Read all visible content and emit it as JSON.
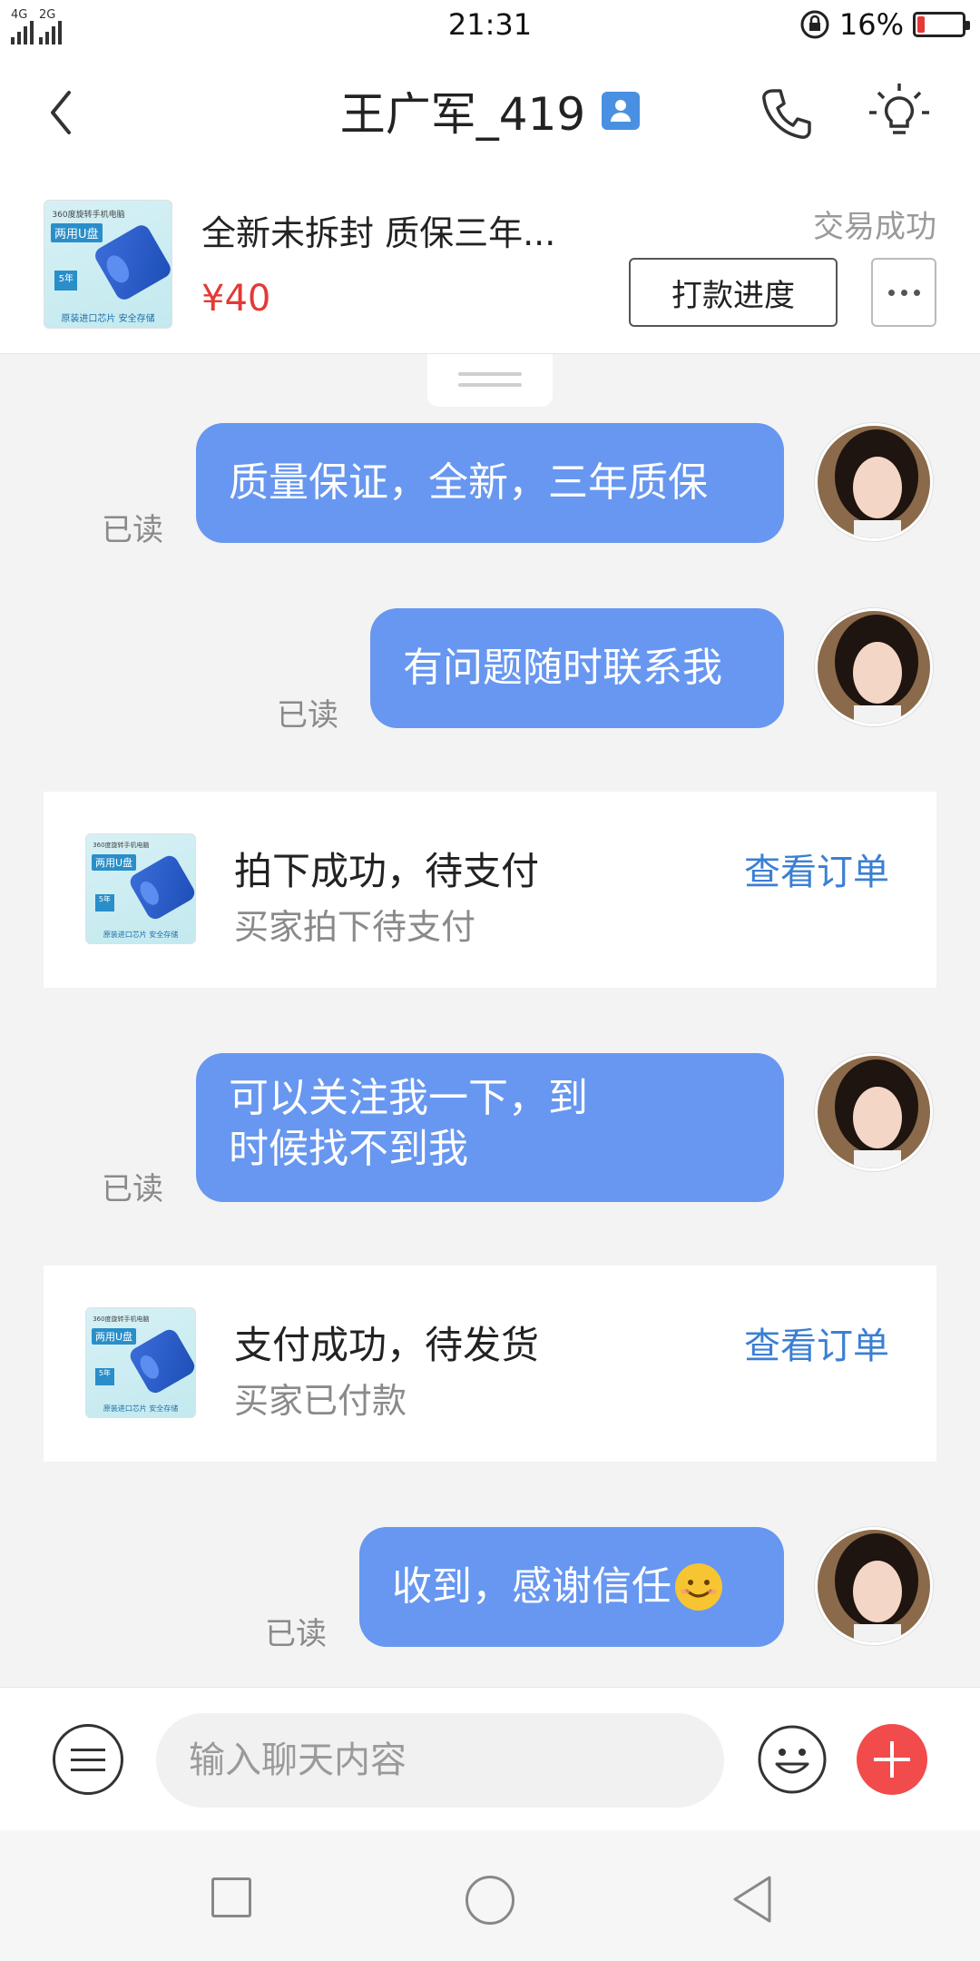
{
  "status_bar": {
    "network_1": "4G",
    "network_2": "2G",
    "time": "21:31",
    "battery_percent": "16%",
    "battery_level": 0.16
  },
  "header": {
    "title": "王广军_419",
    "back_icon": "chevron-left-icon",
    "badge_icon": "person-badge-icon",
    "call_icon": "phone-icon",
    "tip_icon": "lightbulb-icon"
  },
  "product": {
    "thumb_top": "360度旋转手机电脑",
    "thumb_brand": "两用U盘",
    "thumb_five": "5年",
    "thumb_bottom": "原装进口芯片 安全存储",
    "title": "全新未拆封 质保三年...",
    "price": "¥40",
    "status": "交易成功",
    "pay_progress_label": "打款进度",
    "more_icon": "more-dots-icon"
  },
  "messages": [
    {
      "text": "质量保证，全新，三年质保",
      "read": "已读"
    },
    {
      "text": "有问题随时联系我",
      "read": "已读"
    },
    {
      "text": "可以关注我一下，到时候找不到我",
      "read": "已读"
    },
    {
      "text": "收到，感谢信任",
      "read": "已读",
      "emoji_icon": "smiling-face-icon"
    }
  ],
  "system_cards": [
    {
      "title": "拍下成功，待支付",
      "subtitle": "买家拍下待支付",
      "link": "查看订单"
    },
    {
      "title": "支付成功，待发货",
      "subtitle": "买家已付款",
      "link": "查看订单"
    }
  ],
  "input_bar": {
    "placeholder": "输入聊天内容",
    "menu_icon": "menu-icon",
    "emoji_icon": "emoji-icon",
    "plus_icon": "plus-icon"
  },
  "nav_bar": {
    "recent_icon": "square-icon",
    "home_icon": "circle-icon",
    "back_icon": "triangle-back-icon"
  },
  "colors": {
    "bubble": "#6797f0",
    "price": "#e53935",
    "link": "#3b7fd3",
    "plus_button": "#f24b4b"
  }
}
